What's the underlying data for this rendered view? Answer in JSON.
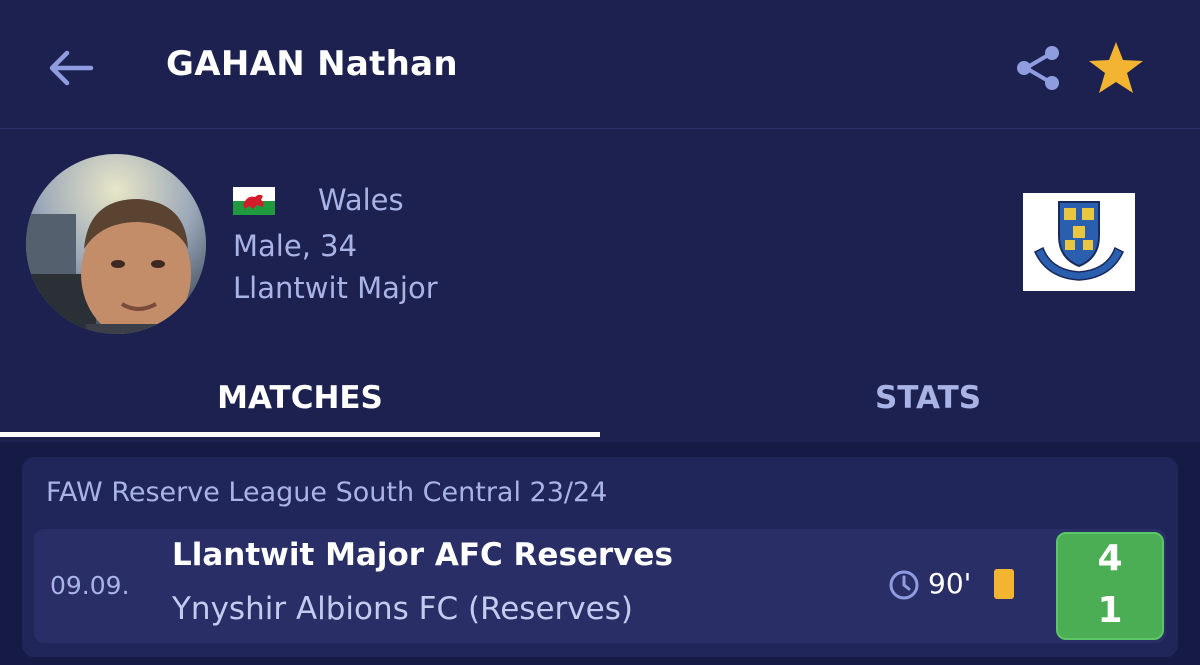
{
  "header": {
    "title": "GAHAN Nathan",
    "back_icon": "arrow-left-icon",
    "share_icon": "share-icon",
    "favorite_icon": "star-icon",
    "favorite_color": "#f2b431"
  },
  "player": {
    "country": "Wales",
    "gender_age": "Male, 34",
    "club": "Llantwit Major",
    "flag_icon": "wales-flag-icon",
    "crest_icon": "club-crest-icon"
  },
  "tabs": [
    {
      "label": "MATCHES",
      "active": true
    },
    {
      "label": "STATS",
      "active": false
    }
  ],
  "league": {
    "title": "FAW Reserve League South Central 23/24",
    "matches": [
      {
        "date": "09.09.",
        "home_team": "Llantwit Major AFC Reserves",
        "away_team": "Ynyshir Albions FC (Reserves)",
        "minutes": "90'",
        "card": "yellow",
        "score_home": "4",
        "score_away": "1",
        "result_color": "#4cae54"
      }
    ]
  },
  "colors": {
    "background": "#1c2150",
    "accent_text": "#a9b3e6",
    "win": "#4cae54",
    "yellow_card": "#f2b431"
  }
}
